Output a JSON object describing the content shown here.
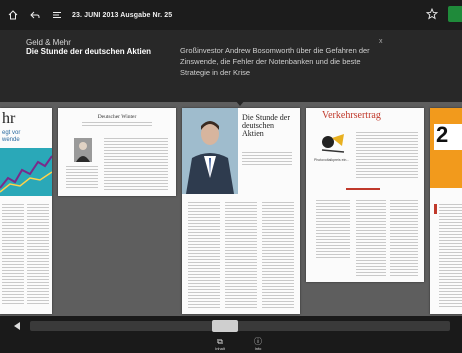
{
  "topbar": {
    "title": "23. JUNI 2013 Ausgabe Nr. 25"
  },
  "overlay": {
    "section": "Geld & Mehr",
    "headline": "Die Stunde der deutschen Aktien",
    "description": "Großinvestor Andrew Bosomworth über die Gefahren der Zinswende, die Fehler der Notenbanken und die beste Strategie in der Krise",
    "close": "x"
  },
  "pages": {
    "p0_head": "hr",
    "p0_sub": "egt vor\nwende",
    "p1_title": "Deutscher Winter",
    "p2_title": "Die Stunde der deutschen Aktien",
    "p3_title": "Verkehrsertrag",
    "p3_sub": "Photovoltaikpreis ein...",
    "p4_num": "2"
  },
  "bottombar": {
    "item1_label": "Inhalt",
    "item2_label": "Info"
  },
  "colors": {
    "topbar": "#1c1c1c",
    "overlay": "#262626",
    "accent_green": "#1f8a3a",
    "orange_page": "#f29a1c",
    "teal_chart": "#2aa8b8"
  }
}
